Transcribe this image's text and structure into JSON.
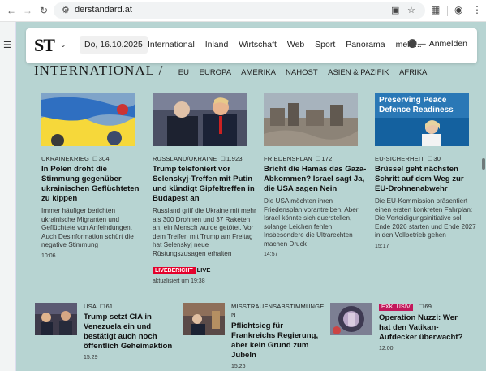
{
  "browser": {
    "url": "derstandard.at"
  },
  "site": {
    "logo": "ST",
    "date": "Do, 16.10.2025",
    "nav": [
      "International",
      "Inland",
      "Wirtschaft",
      "Web",
      "Sport",
      "Panorama",
      "mehr..."
    ],
    "login": "Anmelden"
  },
  "section": {
    "title": "INTERNATIONAL /",
    "links": [
      "EU",
      "EUROPA",
      "AMERIKA",
      "NAHOST",
      "ASIEN & PAZIFIK",
      "AFRIKA"
    ]
  },
  "articles": [
    {
      "kicker": "UKRAINEKRIEG",
      "comments": "304",
      "headline": "In Polen droht die Stimmung gegenüber ukrainischen Geflüchteten zu kippen",
      "teaser": "Immer häufiger berichten ukrainische Migranten und Geflüchtete von Anfeindungen. Auch Desinformation schürt die negative Stimmung",
      "time": "10:06"
    },
    {
      "kicker": "RUSSLAND/UKRAINE",
      "comments": "1.923",
      "headline": "Trump telefoniert vor Selenskyj-Treffen mit Putin und kündigt Gipfeltreffen in Budapest an",
      "teaser": "Russland griff die Ukraine mit mehr als 300 Drohnen und 37 Raketen an, ein Mensch wurde getötet. Vor dem Treffen mit Trump am Freitag hat Selenskyj neue Rüstungszusagen erhalten",
      "live_badge": "LIVEBERICHT",
      "live_text": "LIVE",
      "updated": "aktualisiert um 19:38"
    },
    {
      "kicker": "FRIEDENSPLAN",
      "comments": "172",
      "headline": "Bricht die Hamas das Gaza-Abkommen? Israel sagt Ja, die USA sagen Nein",
      "teaser": "Die USA möchten ihren Friedensplan vorantreiben. Aber Israel könnte sich querstellen, solange Leichen fehlen. Insbesondere die Ultrarechten machen Druck",
      "time": "14:57"
    },
    {
      "kicker": "EU-SICHERHEIT",
      "comments": "30",
      "headline": "Brüssel geht nächsten Schritt auf dem Weg zur EU-Drohnenabwehr",
      "teaser": "Die EU-Kommission präsentiert einen ersten konkreten Fahrplan: Die Verteidigungsinitiative soll Ende 2026 starten und Ende 2027 in den Vollbetrieb gehen",
      "time": "15:17",
      "image_text": "Preserving Peace Defence Readiness"
    }
  ],
  "bottom_articles": [
    {
      "kicker": "USA",
      "comments": "61",
      "headline": "Trump setzt CIA in Venezuela ein und bestätigt auch noch öffentlich Geheimaktion",
      "time": "15:29"
    },
    {
      "kicker": "MISSTRAUENSABSTIMMUNGEN",
      "headline": "Pflichtsieg für Frankreichs Regierung, aber kein Grund zum Jubeln",
      "time": "15:26"
    },
    {
      "badge": "EXKLUSIV",
      "comments": "69",
      "headline": "Operation Nuzzi: Wer hat den Vatikan-Aufdecker überwacht?",
      "time": "12:00"
    }
  ],
  "colors": {
    "page_bg": "#b7d4d2",
    "live": "#e4002b",
    "exklusiv": "#c2185b"
  }
}
